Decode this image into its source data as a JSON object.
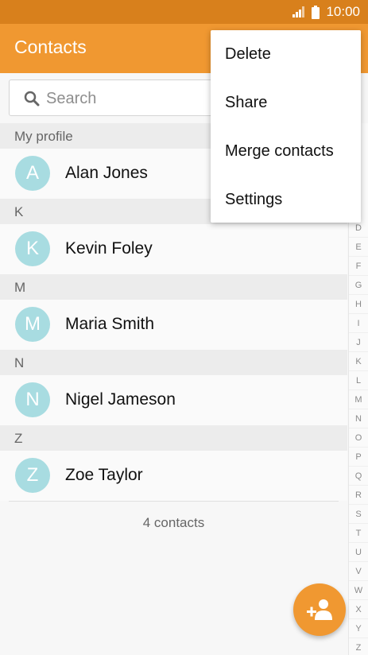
{
  "status_bar": {
    "time": "10:00"
  },
  "app_bar": {
    "title": "Contacts"
  },
  "search": {
    "placeholder": "Search"
  },
  "my_profile": {
    "header": "My profile",
    "initial": "A",
    "name": "Alan Jones"
  },
  "sections": [
    {
      "letter": "K",
      "initial": "K",
      "name": "Kevin Foley"
    },
    {
      "letter": "M",
      "initial": "M",
      "name": "Maria Smith"
    },
    {
      "letter": "N",
      "initial": "N",
      "name": "Nigel Jameson"
    },
    {
      "letter": "Z",
      "initial": "Z",
      "name": "Zoe Taylor"
    }
  ],
  "contact_count": "4 contacts",
  "index_letters": [
    "D",
    "E",
    "F",
    "G",
    "H",
    "I",
    "J",
    "K",
    "L",
    "M",
    "N",
    "O",
    "P",
    "Q",
    "R",
    "S",
    "T",
    "U",
    "V",
    "W",
    "X",
    "Y",
    "Z"
  ],
  "menu": {
    "items": [
      "Delete",
      "Share",
      "Merge contacts",
      "Settings"
    ]
  },
  "colors": {
    "status_bar": "#d8801c",
    "app_bar": "#f09831",
    "avatar": "#a8dce1",
    "fab": "#f09831"
  }
}
